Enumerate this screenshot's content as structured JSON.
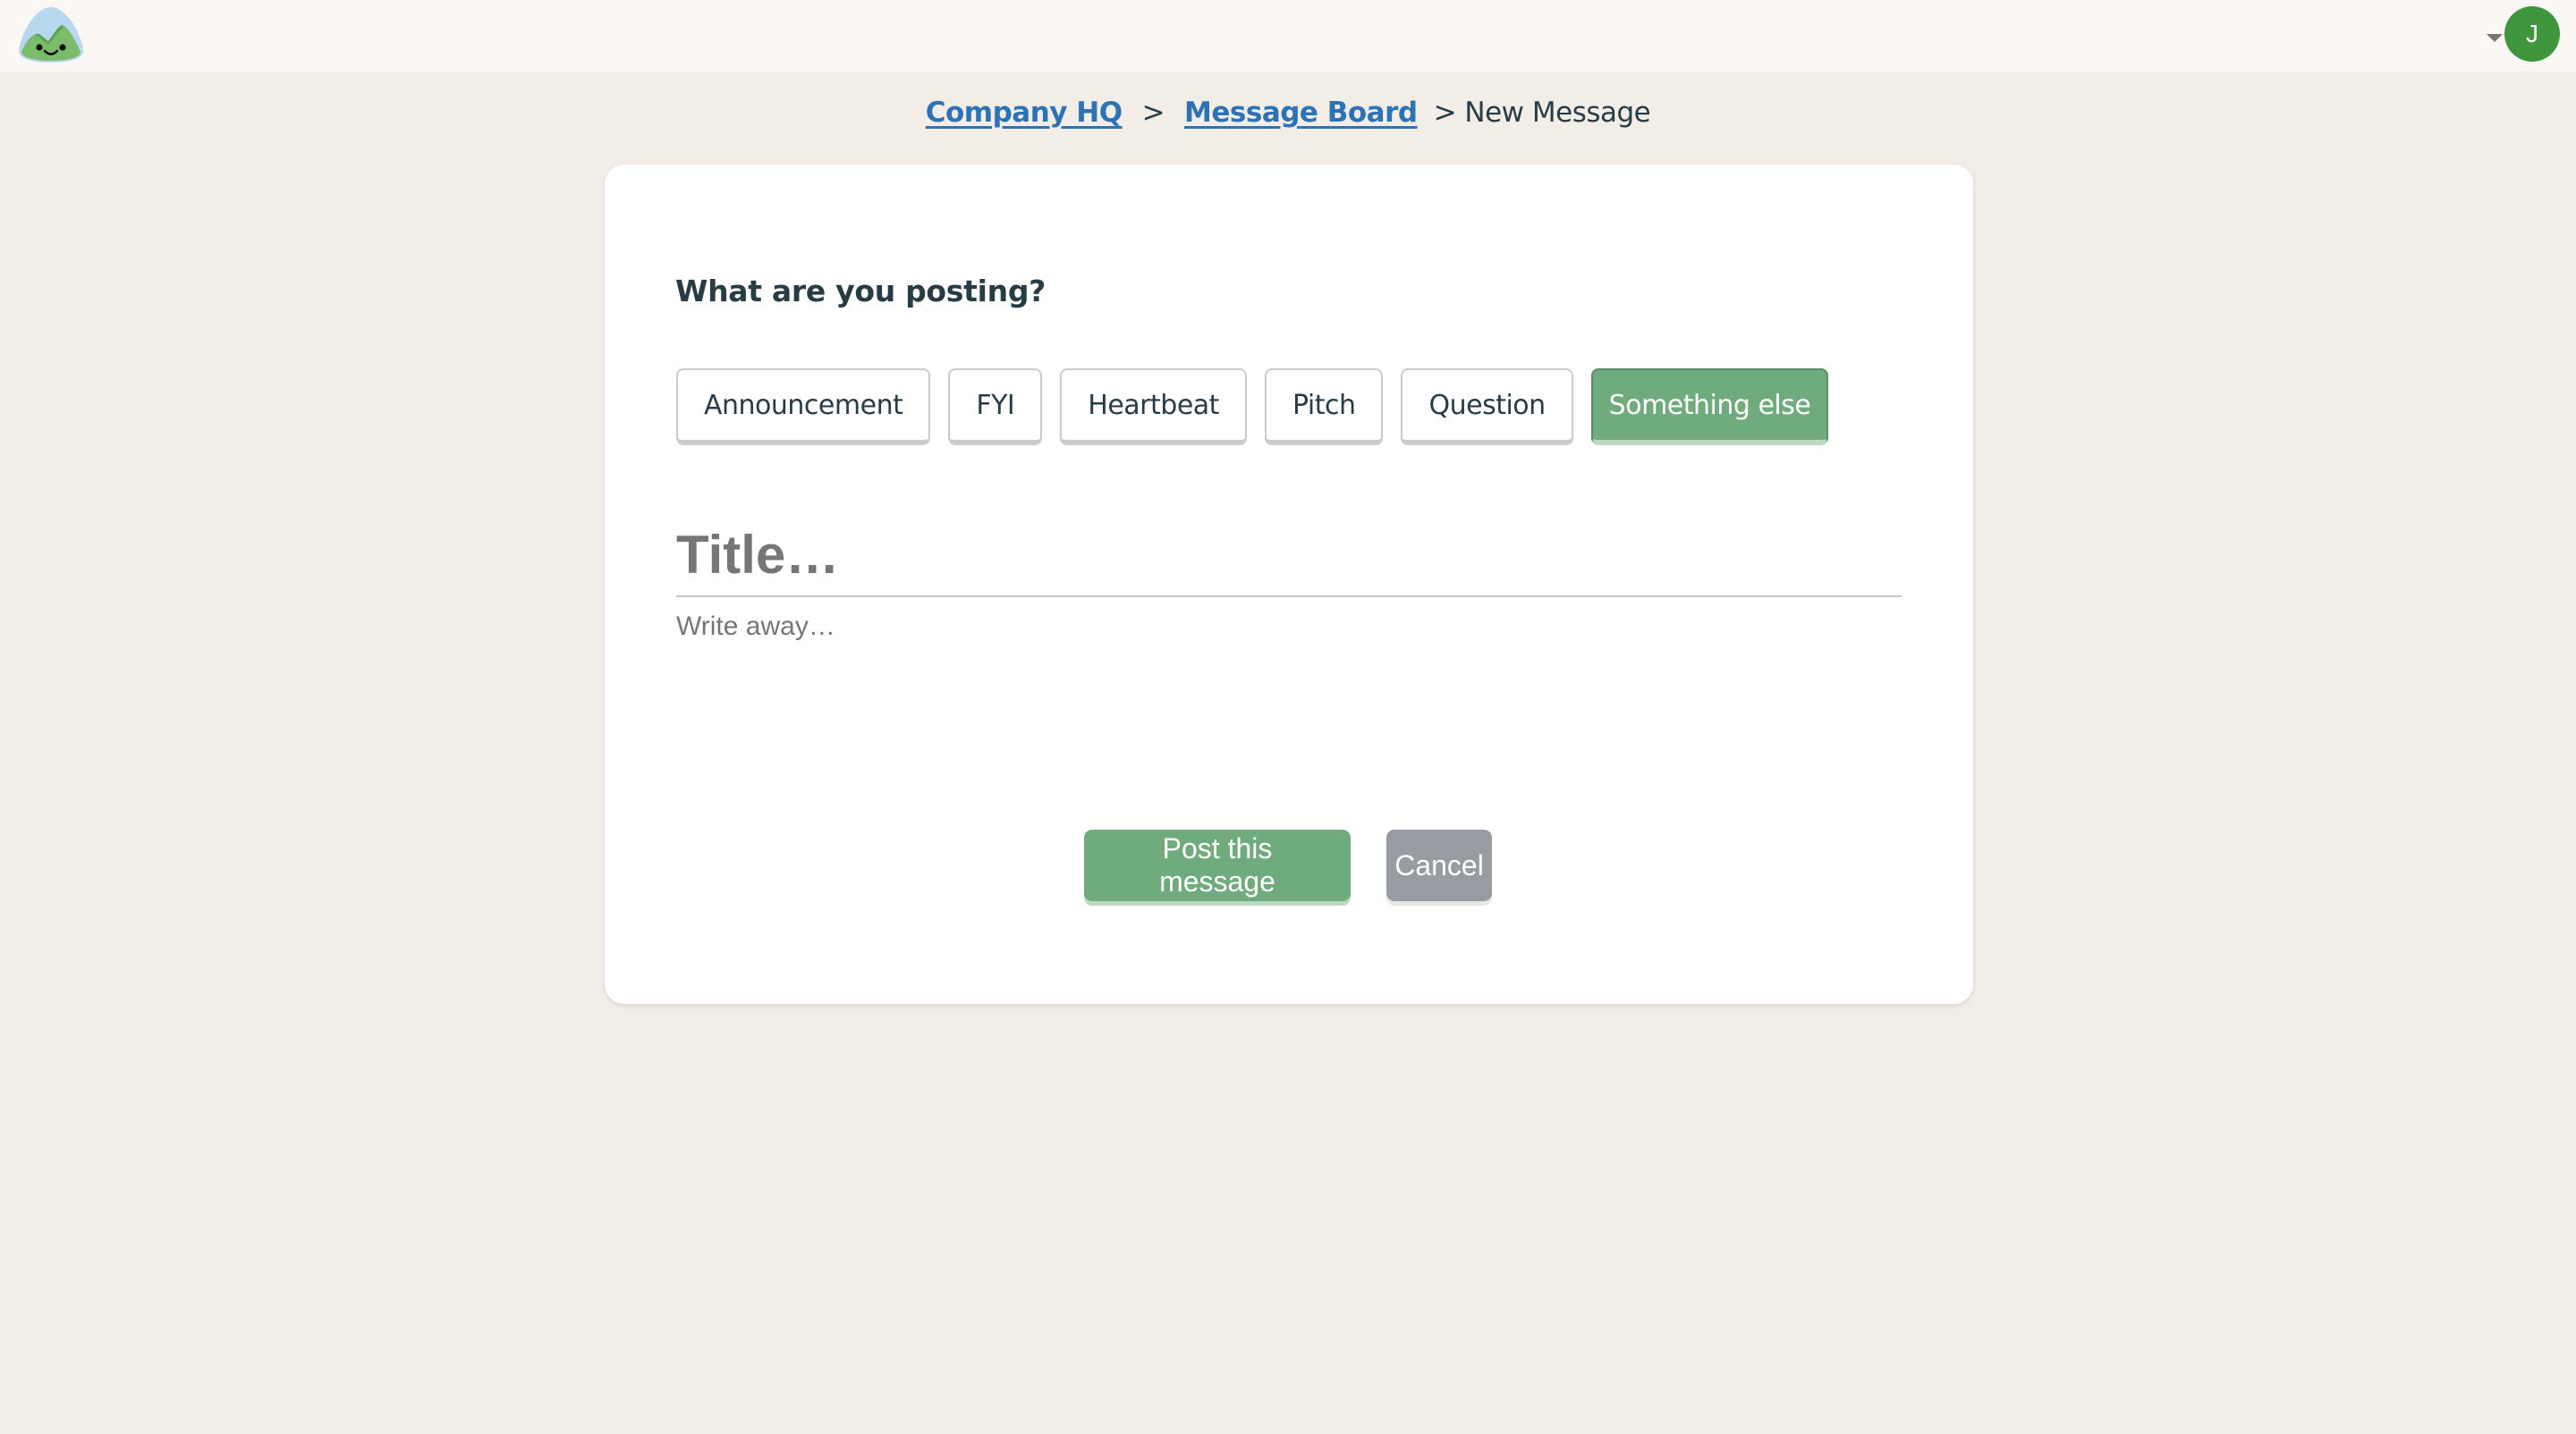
{
  "header": {
    "logo_icon": "basecamp-mountain-logo",
    "account": {
      "caret_icon": "caret-down-icon",
      "avatar_initial": "J",
      "avatar_color": "#3f963c"
    }
  },
  "breadcrumb": {
    "items": [
      {
        "label": "Company HQ",
        "link": true
      },
      {
        "label": "Message Board",
        "link": true
      },
      {
        "label": "New Message",
        "link": false
      }
    ],
    "separator": ">"
  },
  "form": {
    "heading": "What are you posting?",
    "types": [
      {
        "label": "Announcement",
        "selected": false
      },
      {
        "label": "FYI",
        "selected": false
      },
      {
        "label": "Heartbeat",
        "selected": false
      },
      {
        "label": "Pitch",
        "selected": false
      },
      {
        "label": "Question",
        "selected": false
      },
      {
        "label": "Something else",
        "selected": true
      }
    ],
    "title": {
      "value": "",
      "placeholder": "Title…"
    },
    "body": {
      "value": "",
      "placeholder": "Write away…"
    },
    "actions": {
      "post_label": "Post this message",
      "cancel_label": "Cancel"
    }
  },
  "colors": {
    "accent_green": "#6fab7d",
    "link_blue": "#2c73b6",
    "cancel_gray": "#969ca1",
    "page_bg": "#f2ede7",
    "text": "#283c46"
  }
}
